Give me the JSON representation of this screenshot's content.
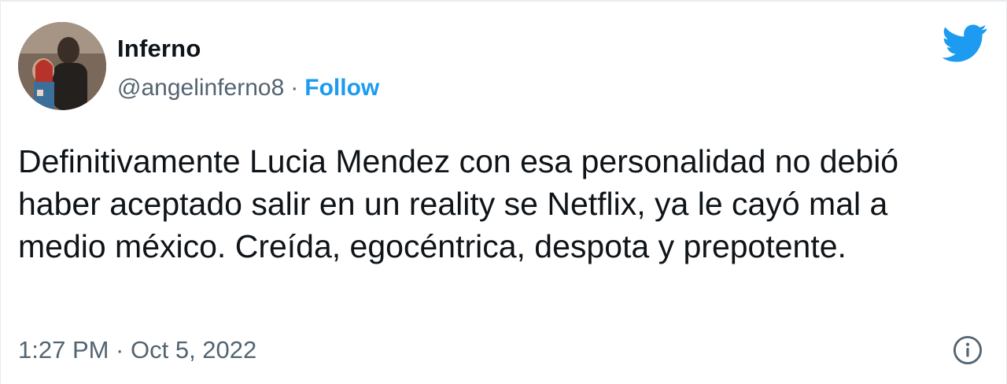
{
  "tweet": {
    "author": {
      "name": "Inferno",
      "handle": "@angelinferno8",
      "separator": "·",
      "follow_label": "Follow",
      "avatar": "profile-photo"
    },
    "text": "Definitivamente Lucia Mendez con esa personalidad no debió haber aceptado salir en un reality se Netflix, ya le cayó mal a medio méxico. Creída, egocéntrica, despota y prepotente.",
    "timestamp": "1:27 PM · Oct 5, 2022",
    "icons": {
      "brand": "twitter-bird-icon",
      "info": "info-icon"
    },
    "colors": {
      "accent": "#1d9bf0",
      "text": "#0f1419",
      "muted": "#536471"
    }
  }
}
